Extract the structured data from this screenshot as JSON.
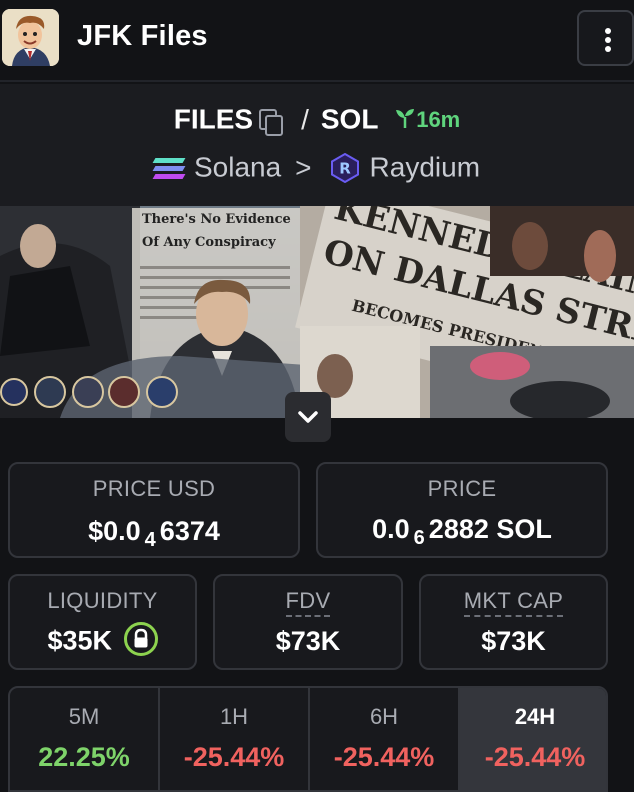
{
  "header": {
    "title": "JFK Files"
  },
  "pair": {
    "base": "FILES",
    "separator": "/",
    "quote": "SOL",
    "age": "16m"
  },
  "chain": {
    "name": "Solana",
    "separator": ">",
    "dex": "Raydium"
  },
  "banner": {
    "headline_1": "There's No Evidence",
    "headline_2": "Of Any Conspiracy",
    "headline_3": "KENNEDY SLAIN",
    "headline_4": "ON DALLAS STREET",
    "headline_5": "BECOMES PRESIDENT"
  },
  "stats": {
    "price_usd": {
      "label": "PRICE USD",
      "prefix": "$0.0",
      "sub": "4",
      "rest": "6374"
    },
    "price": {
      "label": "PRICE",
      "prefix": "0.0",
      "sub": "6",
      "rest": "2882 SOL"
    },
    "liquidity": {
      "label": "LIQUIDITY",
      "value": "$35K"
    },
    "fdv": {
      "label": "FDV",
      "value": "$73K"
    },
    "mkt_cap": {
      "label": "MKT CAP",
      "value": "$73K"
    }
  },
  "timeframes": [
    {
      "label": "5M",
      "value": "22.25%"
    },
    {
      "label": "1H",
      "value": "-25.44%"
    },
    {
      "label": "6H",
      "value": "-25.44%"
    },
    {
      "label": "24H",
      "value": "-25.44%"
    }
  ],
  "colors": {
    "positive": "#7ed36a",
    "negative": "#f0625f",
    "age": "#5fd47d",
    "lock": "#8dd34f"
  }
}
